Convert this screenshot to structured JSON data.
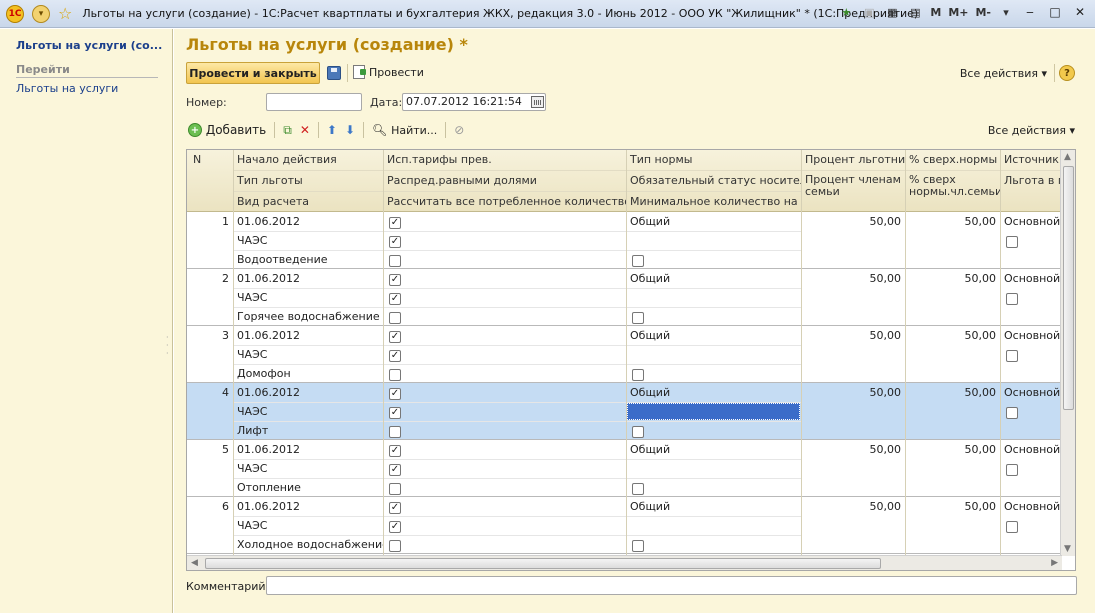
{
  "window": {
    "title": "Льготы на услуги (создание) - 1С:Расчет квартплаты и бухгалтерия ЖКХ, редакция 3.0 - Июнь 2012 - ООО УК \"Жилищник\" * (1С:Предприятие)",
    "logo": "1С",
    "m_labels": [
      "M",
      "M+",
      "M-"
    ]
  },
  "sidebar": {
    "title": "Льготы на услуги (со...",
    "section": "Перейти",
    "link": "Льготы на услуги"
  },
  "form": {
    "title": "Льготы на услуги (создание) *",
    "post_close": "Провести и закрыть",
    "post": "Провести",
    "all_actions": "Все действия",
    "help": "?",
    "number_label": "Номер:",
    "number_value": "",
    "date_label": "Дата:",
    "date_value": "07.07.2012 16:21:54",
    "comment_label": "Комментарий:",
    "comment_value": ""
  },
  "table_toolbar": {
    "add": "Добавить",
    "find": "Найти...",
    "all_actions": "Все действия"
  },
  "table": {
    "headers": {
      "n": "N",
      "c1": [
        "Начало действия",
        "Тип льготы",
        "Вид расчета"
      ],
      "c2": [
        "Исп.тарифы прев.",
        "Распред.равными долями",
        "Рассчитать все потребленное количество"
      ],
      "c3": [
        "Тип нормы",
        "Обязательный статус носителя",
        "Минимальное количество на л..."
      ],
      "c4": [
        "Процент льготни...",
        "Процент членам семьи"
      ],
      "c5": [
        "% сверх.нормы",
        "% сверх нормы.чл.семьи"
      ],
      "c6": [
        "Источник ф",
        "Льгота в пр"
      ]
    },
    "rows": [
      {
        "n": "1",
        "date": "01.06.2012",
        "type": "ЧАЭС",
        "service": "Водоотведение",
        "norm": "Общий",
        "pct": "50,00",
        "over": "50,00",
        "src": "Основной",
        "cb_tariff": true,
        "cb_equal": true,
        "cb_all": false,
        "cb_status": false,
        "cb_src": false
      },
      {
        "n": "2",
        "date": "01.06.2012",
        "type": "ЧАЭС",
        "service": "Горячее водоснабжение",
        "norm": "Общий",
        "pct": "50,00",
        "over": "50,00",
        "src": "Основной",
        "cb_tariff": true,
        "cb_equal": true,
        "cb_all": false,
        "cb_status": false,
        "cb_src": false
      },
      {
        "n": "3",
        "date": "01.06.2012",
        "type": "ЧАЭС",
        "service": "Домофон",
        "norm": "Общий",
        "pct": "50,00",
        "over": "50,00",
        "src": "Основной",
        "cb_tariff": true,
        "cb_equal": true,
        "cb_all": false,
        "cb_status": false,
        "cb_src": false
      },
      {
        "n": "4",
        "date": "01.06.2012",
        "type": "ЧАЭС",
        "service": "Лифт",
        "norm": "Общий",
        "pct": "50,00",
        "over": "50,00",
        "src": "Основной",
        "cb_tariff": true,
        "cb_equal": true,
        "cb_all": false,
        "cb_status": false,
        "cb_src": false
      },
      {
        "n": "5",
        "date": "01.06.2012",
        "type": "ЧАЭС",
        "service": "Отопление",
        "norm": "Общий",
        "pct": "50,00",
        "over": "50,00",
        "src": "Основной",
        "cb_tariff": true,
        "cb_equal": true,
        "cb_all": false,
        "cb_status": false,
        "cb_src": false
      },
      {
        "n": "6",
        "date": "01.06.2012",
        "type": "ЧАЭС",
        "service": "Холодное водоснабжение",
        "norm": "Общий",
        "pct": "50,00",
        "over": "50,00",
        "src": "Основной",
        "cb_tariff": true,
        "cb_equal": true,
        "cb_all": false,
        "cb_status": false,
        "cb_src": false
      }
    ],
    "selected_row": 3
  },
  "colors": {
    "title_accent": "#b8860b",
    "sidebar_bg": "#fbf6da",
    "selected_row": "#c5dcf3",
    "selected_cell": "#3b6cc9"
  }
}
